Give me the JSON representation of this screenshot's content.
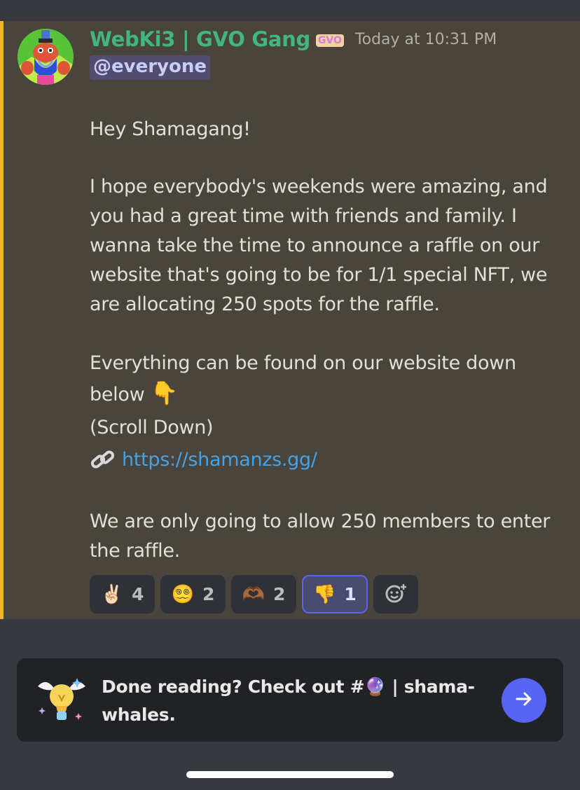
{
  "message": {
    "author": "WebKi3 | GVO Gang",
    "role_badge": "GVO",
    "timestamp": "Today at 10:31 PM",
    "mention": "@everyone",
    "greeting": "Hey Shamagang!",
    "paragraph_1": "I hope everybody's weekends were amazing, and you had a great time with friends and family. I wanna take the time to announce a raffle on our website that's going to be for 1/1 special NFT, we are allocating 250 spots for the raffle.",
    "paragraph_2": "Everything can be found on our website down below",
    "point_down_emoji": "👇",
    "scroll_note": "(Scroll Down)",
    "link_icon": "🔗",
    "link_text": "https://shamanzs.gg/",
    "paragraph_3": "We are only going to allow 250 members to enter the raffle."
  },
  "reactions": [
    {
      "emoji": "✌🏻",
      "icon": "peace-hand-icon",
      "count": "4"
    },
    {
      "emoji": "😵‍💫",
      "icon": "spiral-face-icon",
      "count": "2"
    },
    {
      "emoji": "🫶🏾",
      "icon": "heart-hands-icon",
      "count": "2"
    },
    {
      "emoji": "👎",
      "icon": "thumbs-down-icon",
      "count": "1",
      "active": true
    }
  ],
  "add_reaction_icon": "add-reaction-icon",
  "banner": {
    "text_before": "Done reading? Check out #",
    "channel_emoji": "🔮",
    "text_after": " | shama-whales.",
    "icon": "winged-lightbulb-icon",
    "button_icon": "arrow-right-icon"
  },
  "colors": {
    "background": "#36393f",
    "highlight_background": "#49443c",
    "highlight_border": "#f0b232",
    "username": "#43b581",
    "link": "#44a3e6",
    "accent": "#5865f2"
  }
}
